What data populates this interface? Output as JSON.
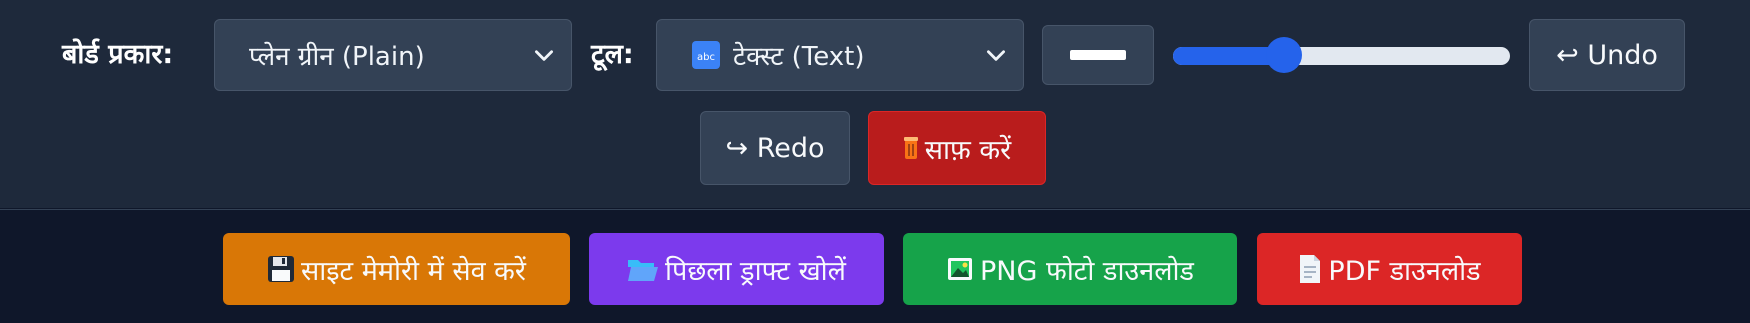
{
  "toolbar": {
    "board_type_label": "बोर्ड प्रकार:",
    "board_type_value": "प्लेन ग्रीन (Plain)",
    "tool_label": "टूल:",
    "tool_value": "टेक्स्ट (Text)",
    "tool_value_icon": "abc-icon",
    "line_width_icon": "line-width-icon",
    "size_slider_value": 0.33,
    "undo_label": "↩ Undo",
    "redo_label": "↪ Redo",
    "clear_label": "साफ़ करें",
    "clear_icon": "trash-icon"
  },
  "actions": {
    "save_label": "साइट मेमोरी में सेव करें",
    "save_icon": "floppy-disk-icon",
    "open_label": "पिछला ड्राफ्ट खोलें",
    "open_icon": "open-folder-icon",
    "png_label": "PNG फोटो डाउनलोड",
    "png_icon": "image-icon",
    "pdf_label": "PDF डाउनलोड",
    "pdf_icon": "document-icon"
  },
  "colors": {
    "toolbar_bg": "#1e293b",
    "page_bg": "#0f172a",
    "save": "#d97706",
    "open": "#7c3aed",
    "png": "#16a34a",
    "pdf": "#dc2626",
    "clear": "#b91c1c",
    "slider": "#2563eb"
  }
}
